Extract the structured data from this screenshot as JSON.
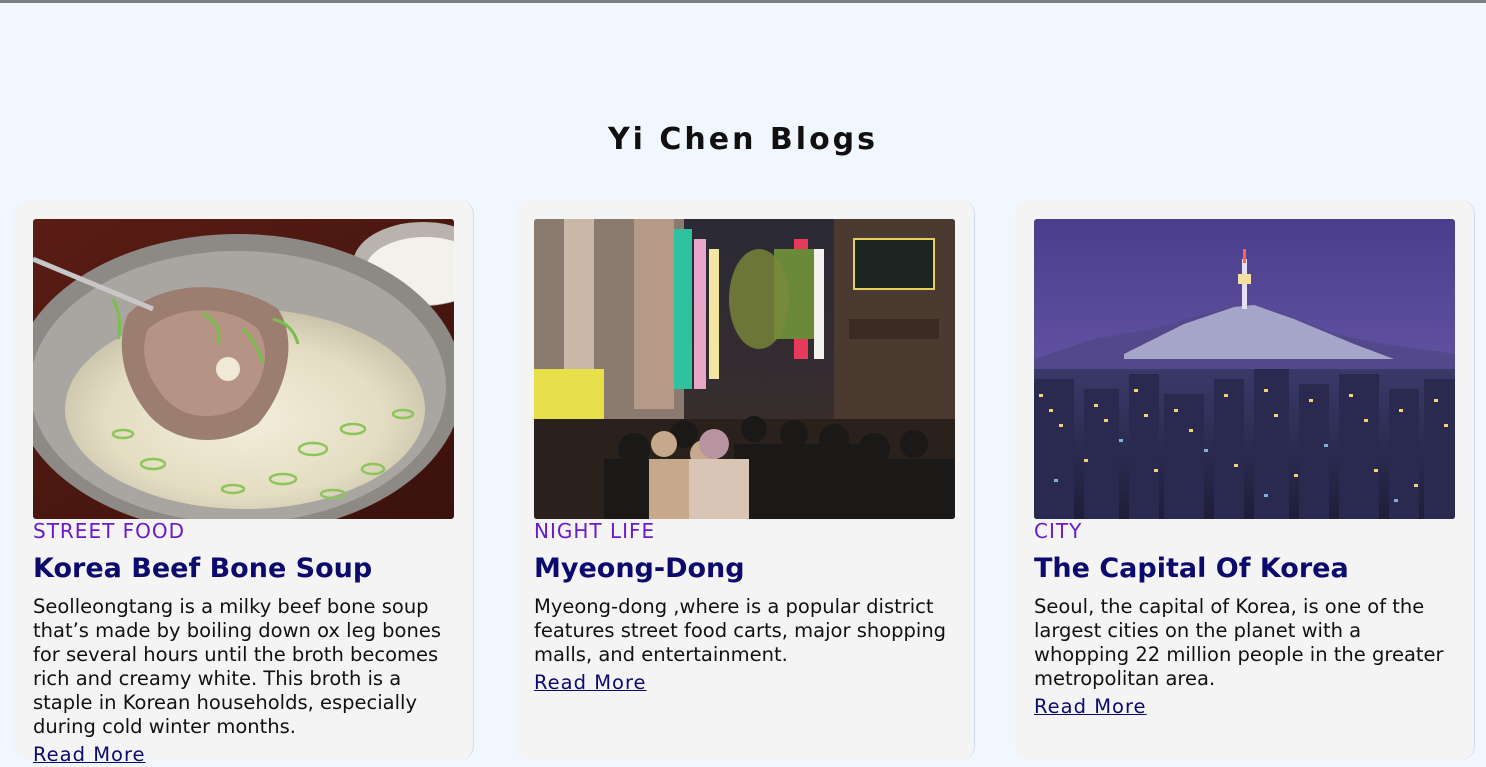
{
  "page": {
    "title": "Yi Chen Blogs"
  },
  "posts": [
    {
      "image_alt": "Korea beef bone soup",
      "category": "STREET FOOD",
      "title": "Korea Beef Bone Soup",
      "excerpt": "Seolleongtang is a milky beef bone soup that’s made by boiling down ox leg bones for several hours until the broth becomes rich and creamy white. This broth is a staple in Korean households, especially during cold winter months.",
      "link": "Read More"
    },
    {
      "image_alt": "Myeong-Dong night street",
      "category": "NIGHT LIFE",
      "title": "Myeong-Dong",
      "excerpt": "Myeong-dong ,where is a popular district features street food carts, major shopping malls, and entertainment.",
      "link": "Read More"
    },
    {
      "image_alt": "Seoul skyline at dusk",
      "category": "CITY",
      "title": "The Capital Of Korea",
      "excerpt": "Seoul, the capital of Korea, is one of the largest cities on the planet with a whopping 22 million people in the greater metropolitan area.",
      "link": "Read More"
    }
  ],
  "colors": {
    "background": "#f0f7fe",
    "card": "#f4f4f5",
    "category": "#6a1bc9",
    "title": "#0d0a6e"
  }
}
